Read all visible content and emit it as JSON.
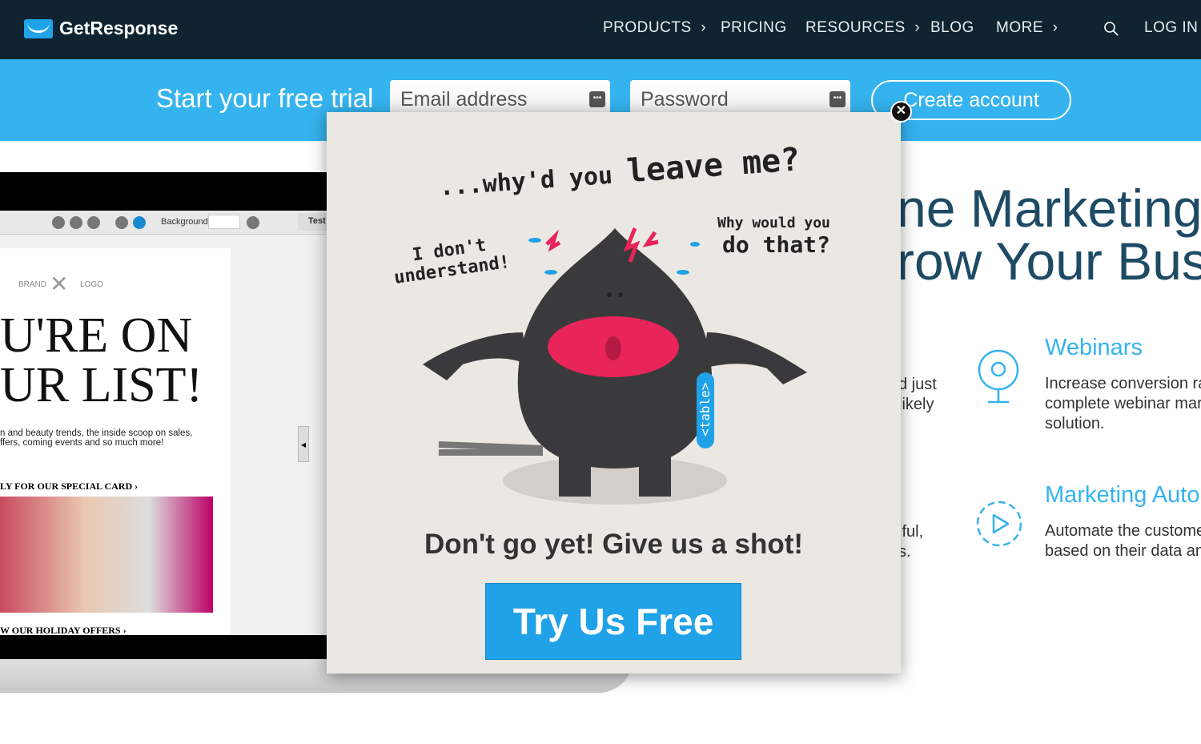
{
  "nav": {
    "brand": "GetResponse",
    "items": [
      {
        "label": "PRODUCTS",
        "chevron": "›"
      },
      {
        "label": "PRICING"
      },
      {
        "label": "RESOURCES",
        "chevron": "›"
      },
      {
        "label": "BLOG"
      },
      {
        "label": "MORE",
        "chevron": "›"
      }
    ],
    "login": "LOG IN"
  },
  "signup": {
    "title": "Start your free trial",
    "email_placeholder": "Email address",
    "password_placeholder": "Password",
    "create": "Create account"
  },
  "editor": {
    "background_label": "Background",
    "test_label": "Test",
    "brand": "BRAND",
    "logo": "LOGO",
    "headline1": "U'RE ON",
    "headline2": "UR LIST!",
    "body1": "n and beauty trends, the inside scoop on sales,",
    "body2": "ffers, coming events and so much more!",
    "link1": "LY FOR OUR SPECIAL CARD ›",
    "link2": "W OUR HOLIDAY OFFERS ›"
  },
  "hero": {
    "line1": "ne Marketing",
    "line2": "row Your Busin",
    "partial1": "d just",
    "partial2": "likely",
    "partial3": "iful,",
    "partial4": "s."
  },
  "features": [
    {
      "title": "Webinars",
      "icon": "webcam-icon",
      "line1": "Increase conversion rat",
      "line2": "complete webinar mark",
      "line3": "solution."
    },
    {
      "title": "Marketing Auto",
      "icon": "gear-play-icon",
      "line1": "Automate the customer",
      "line2": "based on their data and"
    }
  ],
  "modal": {
    "title_a": "...why'd you",
    "title_b": "leave me?",
    "left_a": "I don't",
    "left_b": "understand!",
    "right_a": "Why would you",
    "right_b": "do that?",
    "tag": "<table>",
    "headline": "Don't go yet! Give us a shot!",
    "cta": "Try Us Free",
    "close": "✕"
  },
  "colors": {
    "nav": "#0f2430",
    "accent": "#35b3ef",
    "cta": "#1fa2e8",
    "monster": "#3a3a3c",
    "mouth": "#e8245a"
  }
}
